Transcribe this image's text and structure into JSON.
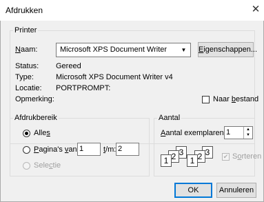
{
  "window": {
    "title": "Afdrukken",
    "close_glyph": "✕"
  },
  "printer": {
    "legend": "Printer",
    "name_label": "Naam:",
    "name_value": "Microsoft XPS Document Writer",
    "properties_button": "Eigenschappen...",
    "status_label": "Status:",
    "status_value": "Gereed",
    "type_label": "Type:",
    "type_value": "Microsoft XPS Document Writer v4",
    "location_label": "Locatie:",
    "location_value": "PORTPROMPT:",
    "comment_label": "Opmerking:",
    "print_to_file_label": "Naar bestand",
    "print_to_file_checked": false
  },
  "range": {
    "legend": "Afdrukbereik",
    "all_label": "Alles",
    "pages_label": "Pagina's",
    "from_label": "van:",
    "from_value": "1",
    "to_label": "t/m:",
    "to_value": "2",
    "selection_label": "Selectie",
    "selected": "all"
  },
  "copies": {
    "legend": "Aantal",
    "count_label": "Aantal exemplaren:",
    "count_value": "1",
    "collate_label": "Sorteren",
    "collate_checked": true,
    "collate_icon_digits": [
      "1",
      "2",
      "3",
      "1",
      "2",
      "3"
    ]
  },
  "buttons": {
    "ok": "OK",
    "cancel": "Annuleren"
  },
  "icons": {
    "combo_arrow": "▼",
    "spin_up": "▲",
    "spin_down": "▼",
    "check": "✔"
  }
}
